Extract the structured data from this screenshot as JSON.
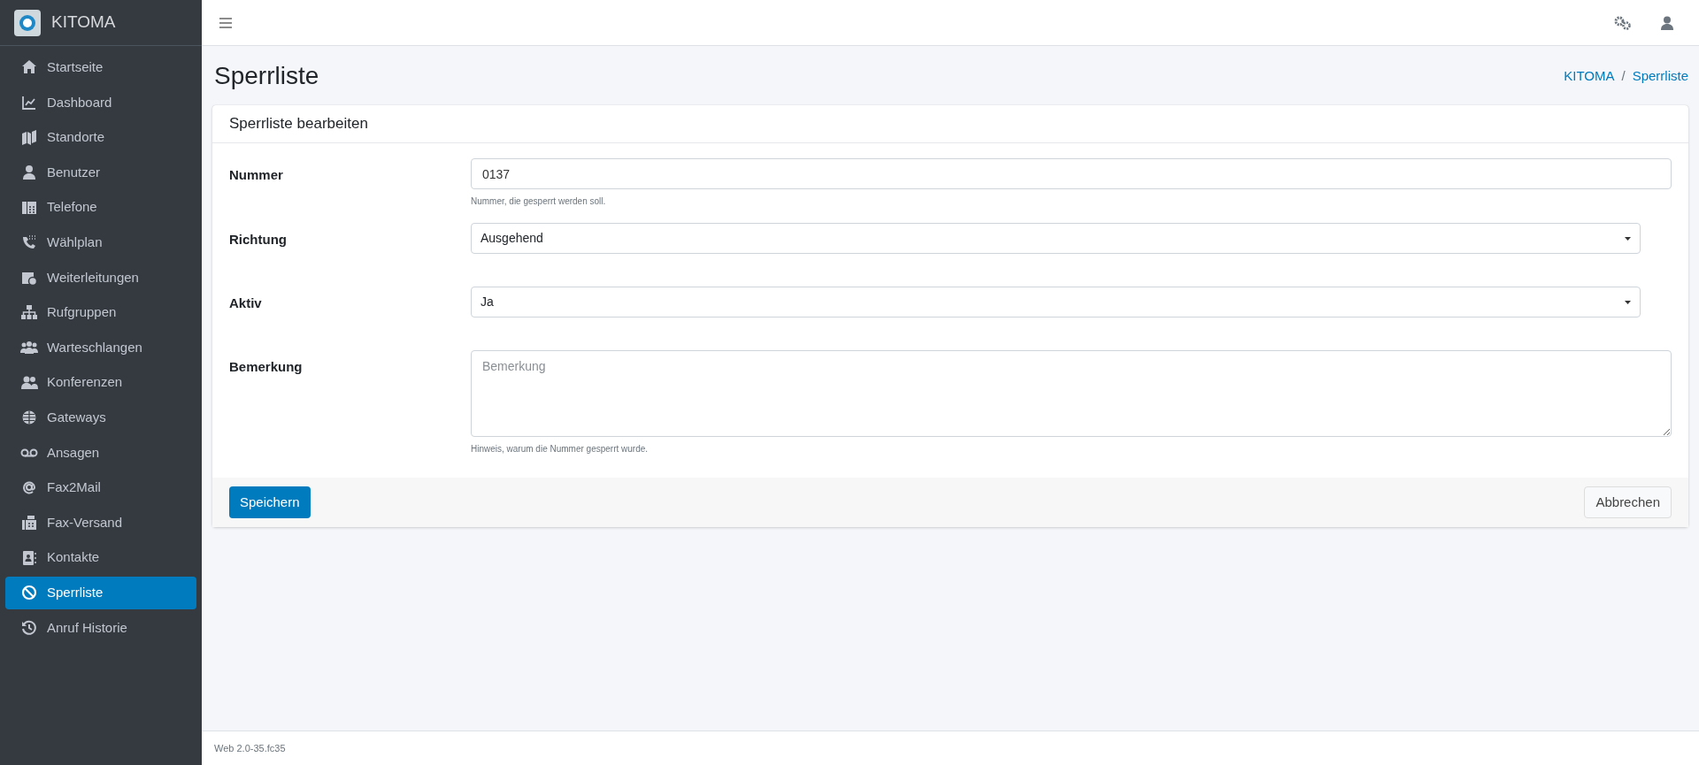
{
  "brand": {
    "name": "KITOMA"
  },
  "sidebar": {
    "items": [
      {
        "label": "Startseite",
        "selected": false
      },
      {
        "label": "Dashboard",
        "selected": false
      },
      {
        "label": "Standorte",
        "selected": false
      },
      {
        "label": "Benutzer",
        "selected": false
      },
      {
        "label": "Telefone",
        "selected": false
      },
      {
        "label": "Wählplan",
        "selected": false
      },
      {
        "label": "Weiterleitungen",
        "selected": false
      },
      {
        "label": "Rufgruppen",
        "selected": false
      },
      {
        "label": "Warteschlangen",
        "selected": false
      },
      {
        "label": "Konferenzen",
        "selected": false
      },
      {
        "label": "Gateways",
        "selected": false
      },
      {
        "label": "Ansagen",
        "selected": false
      },
      {
        "label": "Fax2Mail",
        "selected": false
      },
      {
        "label": "Fax-Versand",
        "selected": false
      },
      {
        "label": "Kontakte",
        "selected": false
      },
      {
        "label": "Sperrliste",
        "selected": true
      },
      {
        "label": "Anruf Historie",
        "selected": false
      }
    ]
  },
  "page": {
    "title": "Sperrliste",
    "breadcrumb": [
      "KITOMA",
      "Sperrliste"
    ],
    "breadcrumb_separator": "/"
  },
  "card": {
    "title": "Sperrliste bearbeiten",
    "fields": [
      {
        "kind": "text",
        "label": "Nummer",
        "value": "0137",
        "hint": "Nummer, die gesperrt werden soll."
      },
      {
        "kind": "select",
        "label": "Richtung",
        "value": "Ausgehend"
      },
      {
        "kind": "select",
        "label": "Aktiv",
        "value": "Ja"
      },
      {
        "kind": "textarea",
        "label": "Bemerkung",
        "placeholder": "Bemerkung",
        "hint": "Hinweis, warum die Nummer gesperrt wurde."
      }
    ],
    "buttons": {
      "save": "Speichern",
      "cancel": "Abbrechen"
    }
  },
  "footer": {
    "version": "Web 2.0-35.fc35"
  }
}
